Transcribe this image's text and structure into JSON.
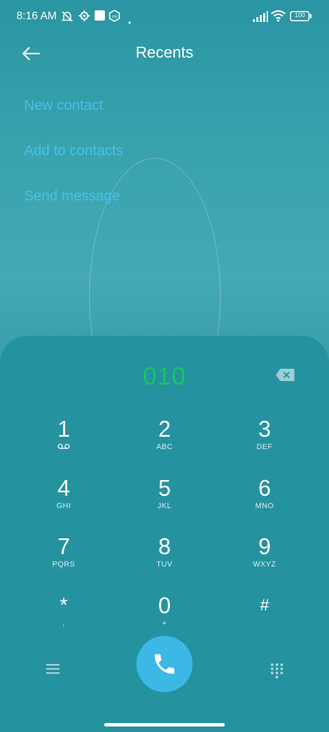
{
  "status_bar": {
    "time": "8:16 AM",
    "battery": "100",
    "icons": [
      "mute-icon",
      "settings-icon",
      "square-icon",
      "shield-icon",
      "dot-icon",
      "signal-icon",
      "wifi-icon",
      "battery-icon"
    ]
  },
  "header": {
    "title": "Recents",
    "back_icon": "arrow-left-icon"
  },
  "actions": [
    {
      "label": "New contact"
    },
    {
      "label": "Add to contacts"
    },
    {
      "label": "Send message"
    }
  ],
  "dialer": {
    "number": "010",
    "keys": [
      {
        "digit": "1",
        "letters": ""
      },
      {
        "digit": "2",
        "letters": "ABC"
      },
      {
        "digit": "3",
        "letters": "DEF"
      },
      {
        "digit": "4",
        "letters": "GHI"
      },
      {
        "digit": "5",
        "letters": "JKL"
      },
      {
        "digit": "6",
        "letters": "MNO"
      },
      {
        "digit": "7",
        "letters": "PQRS"
      },
      {
        "digit": "8",
        "letters": "TUV"
      },
      {
        "digit": "9",
        "letters": "WXYZ"
      },
      {
        "digit": "*",
        "letters": ","
      },
      {
        "digit": "0",
        "letters": "+"
      },
      {
        "digit": "#",
        "letters": ""
      }
    ]
  },
  "colors": {
    "accent_link": "#46c3e8",
    "number_green": "#18c562",
    "call_button": "#3cb8e6",
    "panel": "#2592a0"
  }
}
